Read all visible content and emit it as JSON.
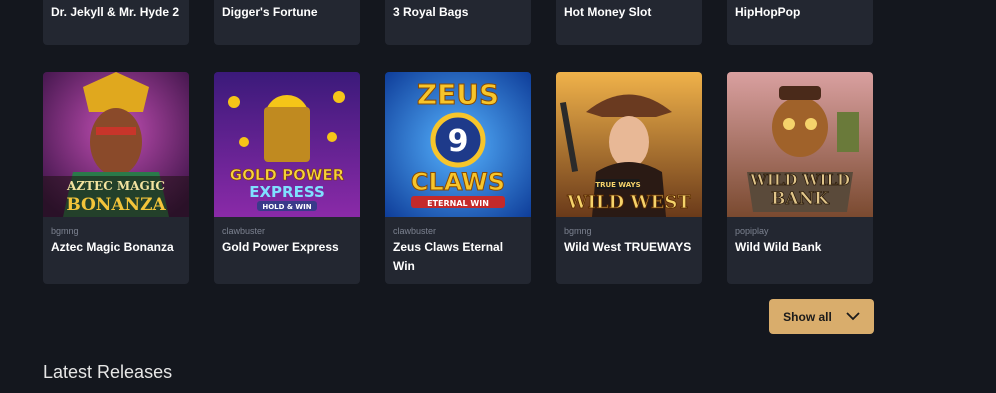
{
  "top_row": [
    {
      "title": "Dr. Jekyll & Mr. Hyde 2"
    },
    {
      "title": "Digger's Fortune"
    },
    {
      "title": "3 Royal Bags"
    },
    {
      "title": "Hot Money Slot"
    },
    {
      "title": "HipHopPop"
    }
  ],
  "games": [
    {
      "provider": "bgmng",
      "title": "Aztec Magic Bonanza",
      "art_line1": "AZTEC MAGIC",
      "art_line2": "BONANZA",
      "colors": {
        "bg": "#7a2a8a",
        "accent": "#f3c43a"
      }
    },
    {
      "provider": "clawbuster",
      "title": "Gold Power Express",
      "art_line1": "GOLD POWER",
      "art_line2": "EXPRESS",
      "art_line3": "HOLD & WIN",
      "colors": {
        "bg": "#5a2aa0",
        "accent": "#f5c518"
      }
    },
    {
      "provider": "clawbuster",
      "title": "Zeus Claws Eternal Win",
      "art_line1": "ZEUS",
      "art_line2": "9",
      "art_line3": "CLAWS",
      "art_line4": "ETERNAL WIN",
      "colors": {
        "bg": "#1f6fd6",
        "accent": "#f7c52b"
      }
    },
    {
      "provider": "bgmng",
      "title": "Wild West TRUEWAYS",
      "art_line1": "TRUE WAYS",
      "art_line2": "WILD WEST",
      "colors": {
        "bg": "#c77a2a",
        "accent": "#f5d36b"
      }
    },
    {
      "provider": "popiplay",
      "title": "Wild Wild Bank",
      "art_line1": "WILD WILD",
      "art_line2": "BANK",
      "colors": {
        "bg": "#8a5a3a",
        "accent": "#e0c58a"
      }
    }
  ],
  "show_all_label": "Show all",
  "section_title": "Latest Releases"
}
